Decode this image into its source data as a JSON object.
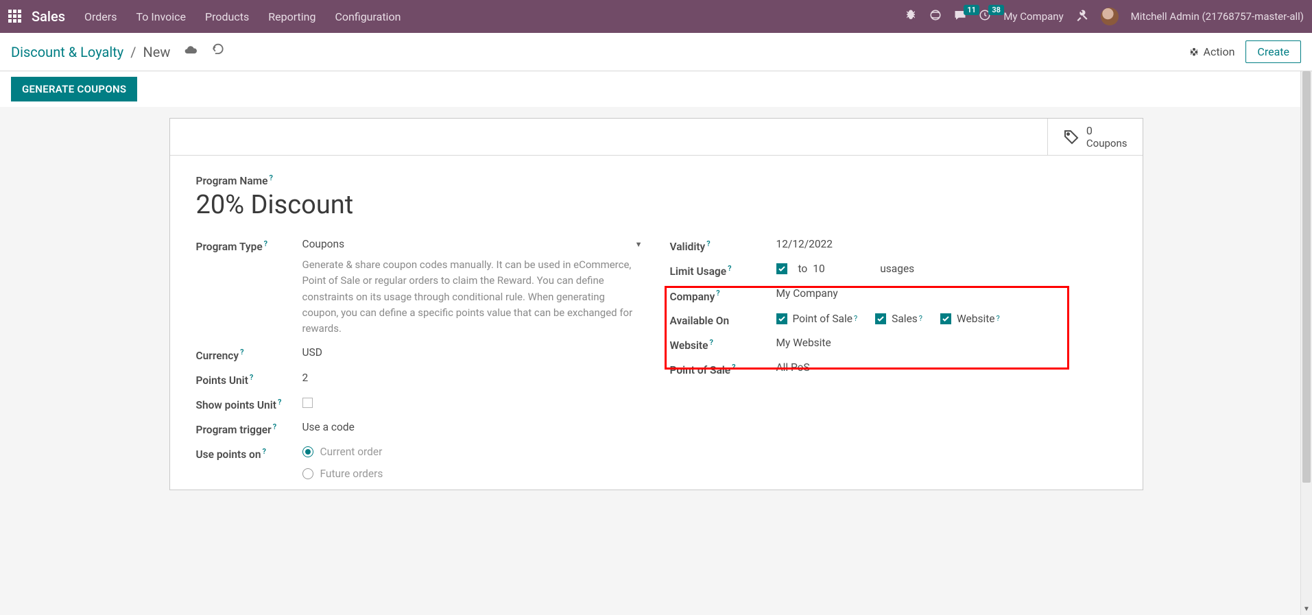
{
  "nav": {
    "brand": "Sales",
    "items": [
      "Orders",
      "To Invoice",
      "Products",
      "Reporting",
      "Configuration"
    ],
    "msg_badge": "11",
    "clock_badge": "38",
    "company": "My Company",
    "user": "Mitchell Admin (21768757-master-all)"
  },
  "breadcrumb": {
    "root": "Discount & Loyalty",
    "current": "New"
  },
  "buttons": {
    "action": "Action",
    "create": "Create",
    "generate": "GENERATE COUPONS"
  },
  "stat": {
    "count": "0",
    "label": "Coupons"
  },
  "form": {
    "program_name_label": "Program Name",
    "program_name_value": "20% Discount",
    "program_type_label": "Program Type",
    "program_type_value": "Coupons",
    "program_type_help": "Generate & share coupon codes manually. It can be used in eCommerce, Point of Sale or regular orders to claim the Reward. You can define constraints on its usage through conditional rule. When generating coupon, you can define a specific points value that can be exchanged for rewards.",
    "currency_label": "Currency",
    "currency_value": "USD",
    "points_unit_label": "Points Unit",
    "points_unit_value": "2",
    "show_points_label": "Show points Unit",
    "trigger_label": "Program trigger",
    "trigger_value": "Use a code",
    "use_points_label": "Use points on",
    "use_points_opts": [
      "Current order",
      "Future orders"
    ],
    "validity_label": "Validity",
    "validity_value": "12/12/2022",
    "limit_label": "Limit Usage",
    "limit_to": "to",
    "limit_val": "10",
    "limit_suffix": "usages",
    "company_label": "Company",
    "company_value": "My Company",
    "available_label": "Available On",
    "available_opts": [
      "Point of Sale",
      "Sales",
      "Website"
    ],
    "website_label": "Website",
    "website_value": "My Website",
    "pos_label": "Point of Sale",
    "pos_placeholder": "All PoS"
  }
}
